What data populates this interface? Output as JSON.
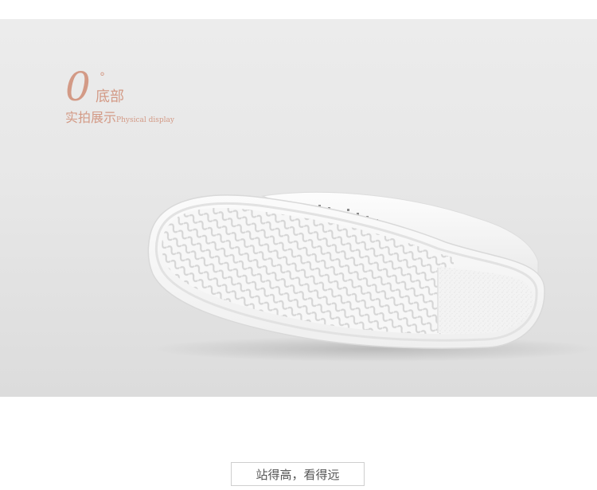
{
  "heading": {
    "number": "0",
    "dot": "°",
    "title": "底部",
    "subtitle_cn": "实拍展示",
    "subtitle_en": "Physical display"
  },
  "photo": {
    "subject": "white-shoe-sole-icon",
    "background_color": "#e6e6e6",
    "accent_color": "#d39a86"
  },
  "caption": {
    "text": "站得高，看得远"
  }
}
